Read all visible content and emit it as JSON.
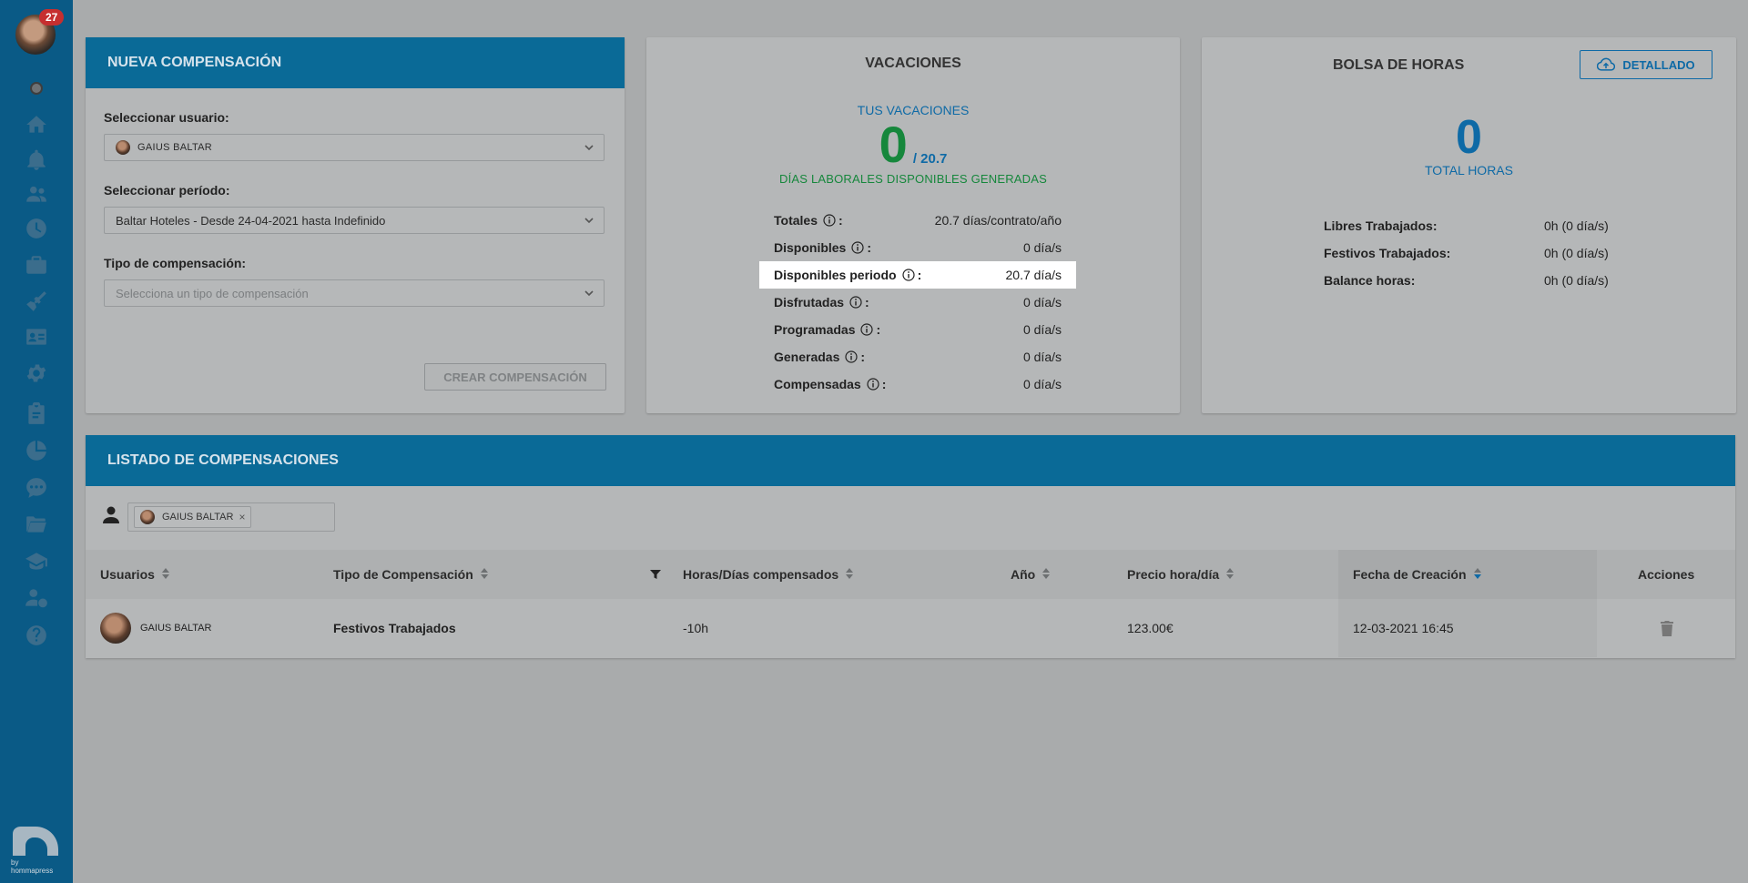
{
  "sidebar": {
    "notification_count": "27",
    "icons": [
      "home-icon",
      "bell-icon",
      "users-icon",
      "clock-icon",
      "briefcase-icon",
      "broom-icon",
      "id-card-icon",
      "gear-icon",
      "clipboard-icon",
      "pie-chart-icon",
      "chat-icon",
      "folder-icon",
      "graduation-cap-icon",
      "user-dollar-icon",
      "help-icon"
    ],
    "brand_text": "by hommapress"
  },
  "nueva": {
    "title": "NUEVA COMPENSACIÓN",
    "user_label": "Seleccionar usuario:",
    "user_value": "GAIUS BALTAR",
    "period_label": "Seleccionar período:",
    "period_value": "Baltar Hoteles - Desde 24-04-2021 hasta Indefinido",
    "type_label": "Tipo de compensación:",
    "type_placeholder": "Selecciona un tipo de compensación",
    "create_button": "CREAR COMPENSACIÓN"
  },
  "vacaciones": {
    "title": "VACACIONES",
    "subtitle": "TUS VACACIONES",
    "available": "0",
    "total": "/ 20.7",
    "caption": "DÍAS LABORALES DISPONIBLES GENERADAS",
    "rows": [
      {
        "label": "Totales",
        "value": "20.7 días/contrato/año"
      },
      {
        "label": "Disponibles",
        "value": "0 día/s"
      },
      {
        "label": "Disponibles periodo",
        "value": "20.7 día/s"
      },
      {
        "label": "Disfrutadas",
        "value": "0 día/s"
      },
      {
        "label": "Programadas",
        "value": "0 día/s"
      },
      {
        "label": "Generadas",
        "value": "0 día/s"
      },
      {
        "label": "Compensadas",
        "value": "0 día/s"
      }
    ]
  },
  "bolsa": {
    "title": "BOLSA DE HORAS",
    "detail_button": "DETALLADO",
    "total": "0",
    "total_label": "TOTAL HORAS",
    "rows": [
      {
        "label": "Libres Trabajados:",
        "value": "0h (0 día/s)"
      },
      {
        "label": "Festivos Trabajados:",
        "value": "0h (0 día/s)"
      },
      {
        "label": "Balance horas:",
        "value": "0h (0 día/s)"
      }
    ]
  },
  "listado": {
    "title": "LISTADO DE COMPENSACIONES",
    "filter_chip": "GAIUS BALTAR",
    "columns": {
      "usuarios": "Usuarios",
      "tipo": "Tipo de Compensación",
      "horas": "Horas/Días compensados",
      "anio": "Año",
      "precio": "Precio hora/día",
      "fecha": "Fecha de Creación",
      "acciones": "Acciones"
    },
    "rows": [
      {
        "usuario": "GAIUS BALTAR",
        "tipo": "Festivos Trabajados",
        "horas": "-10h",
        "anio": "",
        "precio": "123.00€",
        "fecha": "12-03-2021 16:45"
      }
    ]
  }
}
